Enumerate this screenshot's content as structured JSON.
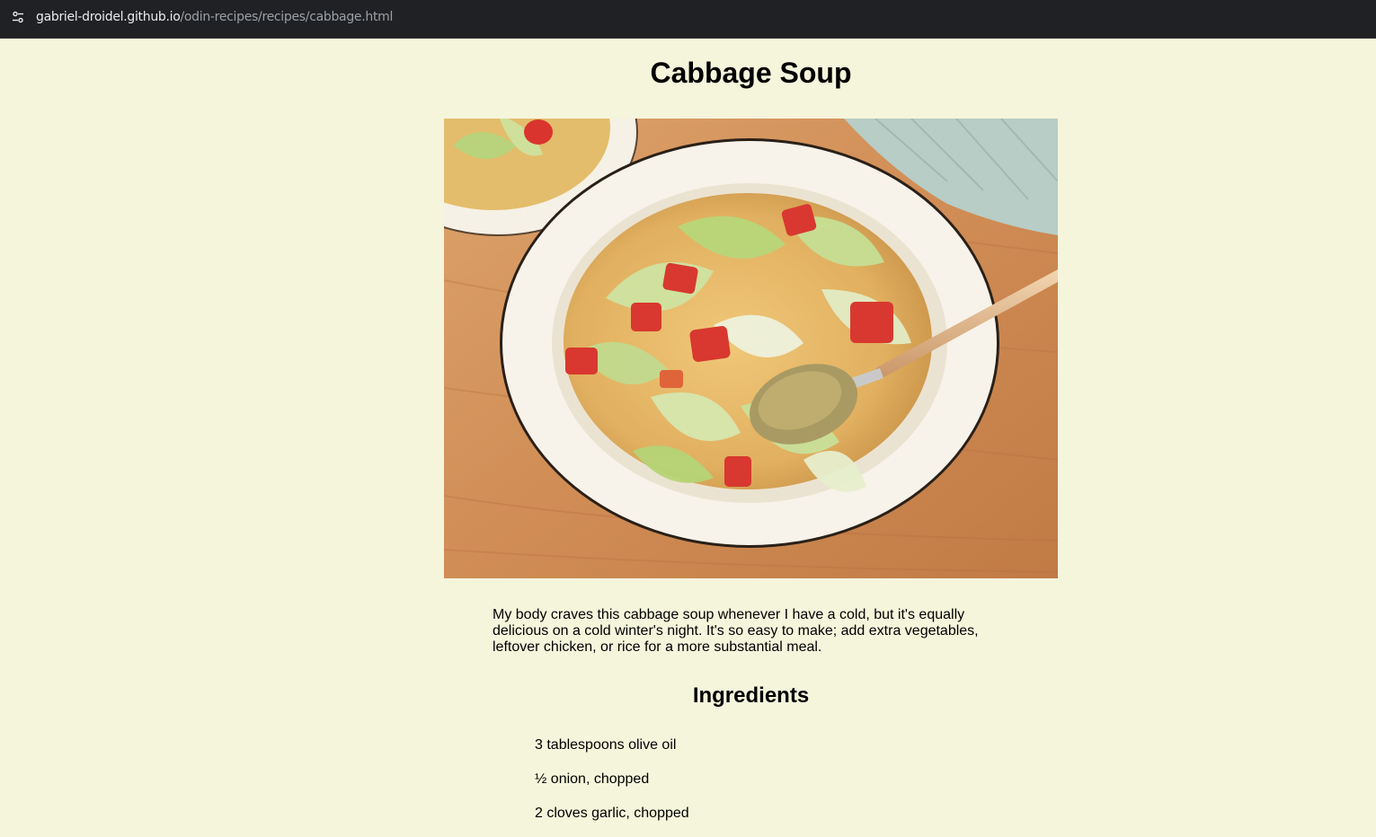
{
  "browser": {
    "url_host": "gabriel-droidel.github.io",
    "url_path": "/odin-recipes/recipes/cabbage.html"
  },
  "recipe": {
    "title": "Cabbage Soup",
    "image_alt": "Cabbage Soup",
    "description": "My body craves this cabbage soup whenever I have a cold, but it's equally delicious on a cold winter's night. It's so easy to make; add extra vegetables, leftover chicken, or rice for a more substantial meal.",
    "ingredients_heading": "Ingredients",
    "ingredients": [
      "3 tablespoons olive oil",
      "½ onion, chopped",
      "2 cloves garlic, chopped"
    ]
  },
  "colors": {
    "page_background": "#f5f5dc",
    "browser_bar": "#202124"
  }
}
